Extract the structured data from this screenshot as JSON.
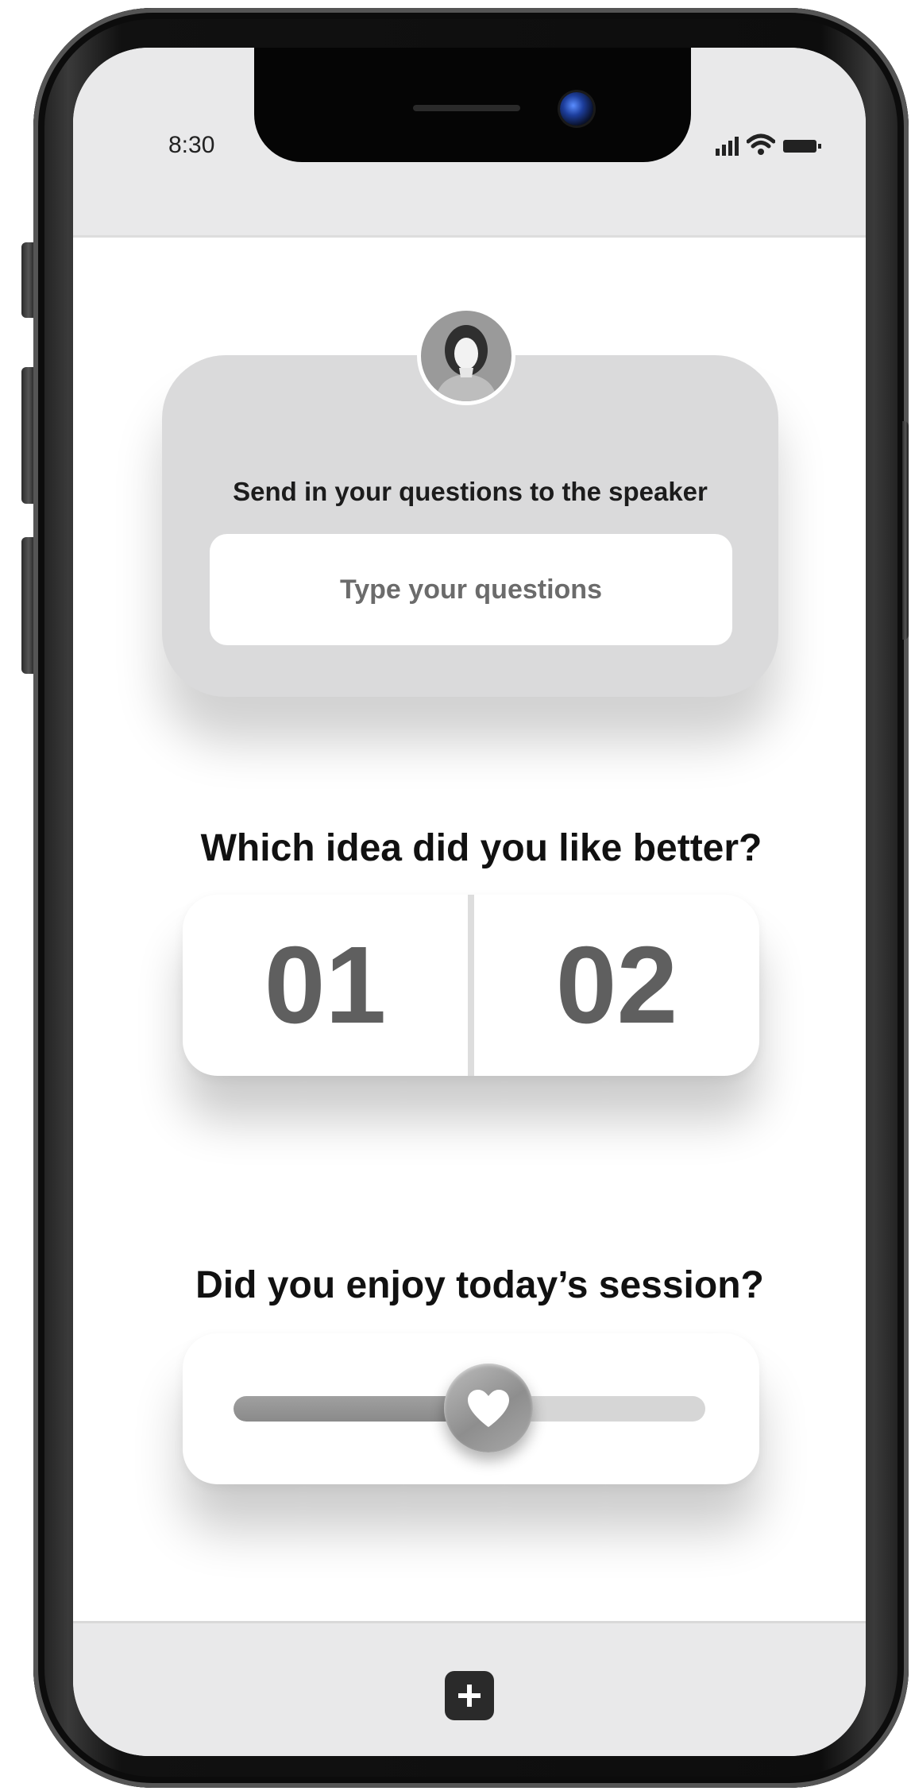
{
  "status_bar": {
    "time": "8:30",
    "icons": [
      "signal-icon",
      "wifi-icon",
      "battery-icon"
    ]
  },
  "question_card": {
    "title": "Send in your questions to the speaker",
    "input_placeholder": "Type your questions",
    "avatar_icon": "person-avatar-icon"
  },
  "poll": {
    "title": "Which idea did you like better?",
    "options": [
      {
        "label": "01"
      },
      {
        "label": "02"
      }
    ]
  },
  "rating": {
    "title": "Did you enjoy today’s session?",
    "value_fraction": 0.54,
    "thumb_icon": "heart-icon"
  },
  "bottom_bar": {
    "action_icon": "plus-icon"
  },
  "colors": {
    "card_gray": "#dadadb",
    "text_dark": "#111111",
    "poll_number": "#5f5f5f",
    "slider_fill": "#8a8a8a",
    "slider_track": "#d6d6d6",
    "add_button": "#2a2a2a"
  }
}
